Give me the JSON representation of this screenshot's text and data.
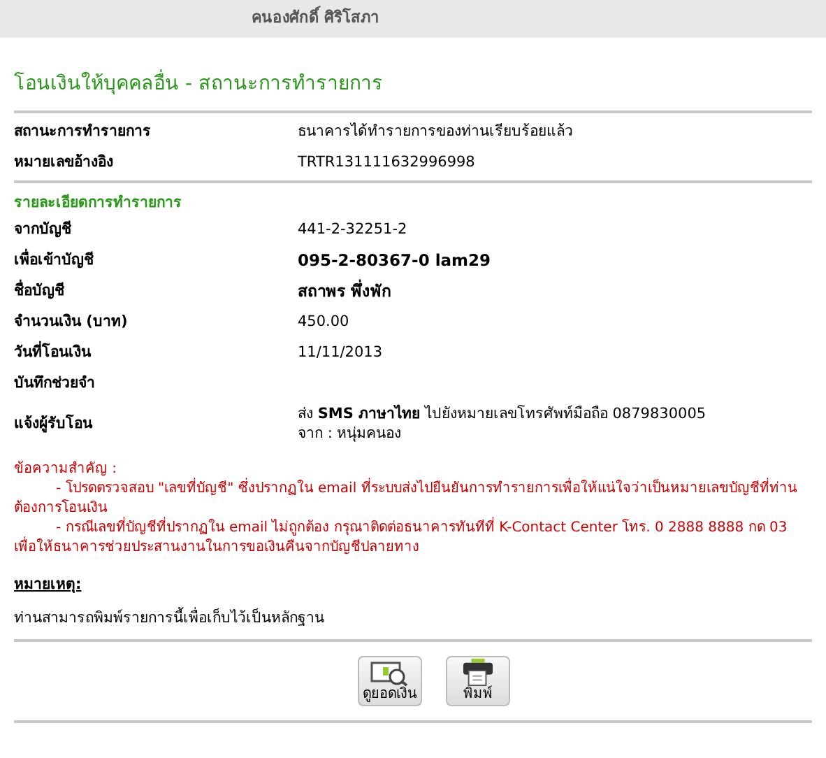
{
  "header": {
    "user_name": "คนองศักดิ์ ศิริโสภา"
  },
  "title": "โอนเงินให้บุคคลอื่น - สถานะการทำรายการ",
  "status_rows": [
    {
      "label": "สถานะการทำรายการ",
      "value": "ธนาคารได้ทำรายการของท่านเรียบร้อยแล้ว"
    },
    {
      "label": "หมายเลขอ้างอิง",
      "value": "TRTR131111632996998"
    }
  ],
  "details": {
    "heading": "รายละเอียดการทำรายการ",
    "rows": [
      {
        "label": "จากบัญชี",
        "value": "441-2-32251-2"
      },
      {
        "label": "เพื่อเข้าบัญชี",
        "value": "095-2-80367-0 lam29",
        "bold": true
      },
      {
        "label": "ชื่อบัญชี",
        "value": "สถาพร พึ่งพัก",
        "bold": true
      },
      {
        "label": "จำนวนเงิน (บาท)",
        "value": "450.00"
      },
      {
        "label": "วันที่โอนเงิน",
        "value": "11/11/2013"
      },
      {
        "label": "บันทึกช่วยจำ"
      },
      {
        "label": "แจ้งผู้รับโอน",
        "value": "ส่ง **SMS ภาษาไทย** ไปยังหมายเลขโทรศัพท์มือถือ 0879830005",
        "value_line_2": "จาก : หนุ่มคนอง"
      }
    ]
  },
  "important": {
    "title": "ข้อความสำคัญ :",
    "items": [
      "- โปรดตรวจสอบ \"เลขที่บัญชี\" ซึ่งปรากฏใน email ที่ระบบส่งไปยืนยันการทำรายการเพื่อให้แน่ใจว่าเป็นหมายเลขบัญชีที่ท่านต้องการโอนเงิน",
      "- กรณีเลขที่บัญชีที่ปรากฏใน email ไม่ถูกต้อง กรุณาติดต่อธนาคารทันทีที่ K-Contact Center โทร. 0 2888 8888 กด 03 เพื่อให้ธนาคารช่วยประสานงานในการขอเงินคืนจากบัญชีปลายทาง"
    ]
  },
  "remark": {
    "title": "หมายเหตุ:",
    "text": "ท่านสามารถพิมพ์รายการนี้เพื่อเก็บไว้เป็นหลักฐาน"
  },
  "buttons": [
    {
      "kind": "balance",
      "label": "ดูยอดเงิน"
    },
    {
      "kind": "print",
      "label": "พิมพ์"
    }
  ]
}
